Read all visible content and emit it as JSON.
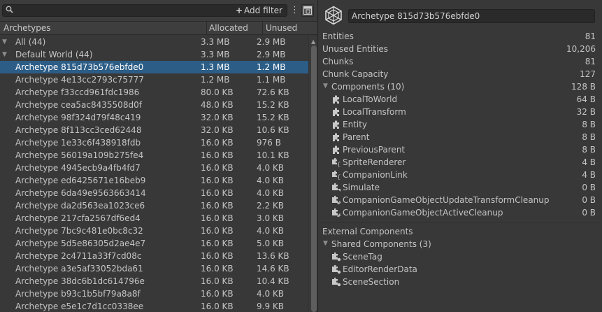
{
  "toolbar": {
    "add_filter_label": "Add filter",
    "add_filter_plus": "+",
    "menu_glyph": "⋮"
  },
  "columns": {
    "name": "Archetypes",
    "allocated": "Allocated",
    "unused": "Unused"
  },
  "rows": [
    {
      "name": "All (44)",
      "allocated": "3.3 MB",
      "unused": "2.9 MB"
    },
    {
      "name": "Default World (44)",
      "allocated": "3.3 MB",
      "unused": "2.9 MB"
    },
    {
      "name": "Archetype 815d73b576ebfde0",
      "allocated": "1.3 MB",
      "unused": "1.2 MB"
    },
    {
      "name": "Archetype 4e13cc2793c75777",
      "allocated": "1.2 MB",
      "unused": "1.1 MB"
    },
    {
      "name": "Archetype f33ccd961fdc1986",
      "allocated": "80.0 KB",
      "unused": "72.6 KB"
    },
    {
      "name": "Archetype cea5ac8435508d0f",
      "allocated": "48.0 KB",
      "unused": "15.2 KB"
    },
    {
      "name": "Archetype 98f324d79f48c419",
      "allocated": "32.0 KB",
      "unused": "15.2 KB"
    },
    {
      "name": "Archetype 8f113cc3ced62448",
      "allocated": "32.0 KB",
      "unused": "10.6 KB"
    },
    {
      "name": "Archetype 1e33c6f438918fdb",
      "allocated": "16.0 KB",
      "unused": "976 B"
    },
    {
      "name": "Archetype 56019a109b275fe4",
      "allocated": "16.0 KB",
      "unused": "10.1 KB"
    },
    {
      "name": "Archetype 4945ecb9a4fb4fd7",
      "allocated": "16.0 KB",
      "unused": "4.0 KB"
    },
    {
      "name": "Archetype ed6425671e16beb9",
      "allocated": "16.0 KB",
      "unused": "4.0 KB"
    },
    {
      "name": "Archetype 6da49e9563663414",
      "allocated": "16.0 KB",
      "unused": "4.0 KB"
    },
    {
      "name": "Archetype da2d563ea1023ce6",
      "allocated": "16.0 KB",
      "unused": "2.2 KB"
    },
    {
      "name": "Archetype 217cfa2567df6ed4",
      "allocated": "16.0 KB",
      "unused": "3.0 KB"
    },
    {
      "name": "Archetype 7bc9c481e0bc8c32",
      "allocated": "16.0 KB",
      "unused": "4.0 KB"
    },
    {
      "name": "Archetype 5d5e86305d2ae4e7",
      "allocated": "16.0 KB",
      "unused": "5.0 KB"
    },
    {
      "name": "Archetype 2c4711a33f7cd08c",
      "allocated": "16.0 KB",
      "unused": "13.6 KB"
    },
    {
      "name": "Archetype a3e5af33052bda61",
      "allocated": "16.0 KB",
      "unused": "14.6 KB"
    },
    {
      "name": "Archetype 38dc6b1dc614796e",
      "allocated": "16.0 KB",
      "unused": "10.4 KB"
    },
    {
      "name": "Archetype b93c1b5bf79a8a8f",
      "allocated": "16.0 KB",
      "unused": "4.0 KB"
    },
    {
      "name": "Archetype e5e1c7d1cc0338ee",
      "allocated": "16.0 KB",
      "unused": "9.9 KB"
    }
  ],
  "inspector": {
    "title": "Archetype 815d73b576ebfde0",
    "stats": [
      {
        "label": "Entities",
        "value": "81"
      },
      {
        "label": "Unused Entities",
        "value": "10,206"
      },
      {
        "label": "Chunks",
        "value": "81"
      },
      {
        "label": "Chunk Capacity",
        "value": "127"
      }
    ],
    "components_title": "Components (10)",
    "components_size": "128 B",
    "components": [
      {
        "name": "LocalToWorld",
        "size": "64 B",
        "icon": "puzzle-icon"
      },
      {
        "name": "LocalTransform",
        "size": "32 B",
        "icon": "puzzle-icon"
      },
      {
        "name": "Entity",
        "size": "8 B",
        "icon": "puzzle-icon"
      },
      {
        "name": "Parent",
        "size": "8 B",
        "icon": "puzzle-icon"
      },
      {
        "name": "PreviousParent",
        "size": "8 B",
        "icon": "puzzle-icon"
      },
      {
        "name": "SpriteRenderer",
        "size": "4 B",
        "icon": "managed-component-icon"
      },
      {
        "name": "CompanionLink",
        "size": "4 B",
        "icon": "managed-component-icon"
      },
      {
        "name": "Simulate",
        "size": "0 B",
        "icon": "tag-component-icon"
      },
      {
        "name": "CompanionGameObjectUpdateTransformCleanup",
        "size": "0 B",
        "icon": "cleanup-component-icon"
      },
      {
        "name": "CompanionGameObjectActiveCleanup",
        "size": "0 B",
        "icon": "cleanup-component-icon"
      }
    ],
    "external_title": "External Components",
    "shared_title": "Shared Components (3)",
    "shared": [
      {
        "name": "SceneTag",
        "icon": "shared-component-icon"
      },
      {
        "name": "EditorRenderData",
        "icon": "shared-component-icon"
      },
      {
        "name": "SceneSection",
        "icon": "shared-component-icon"
      }
    ]
  },
  "colors": {
    "selection": "#2c5d87",
    "background": "#383838",
    "text": "#c4c4c4"
  }
}
